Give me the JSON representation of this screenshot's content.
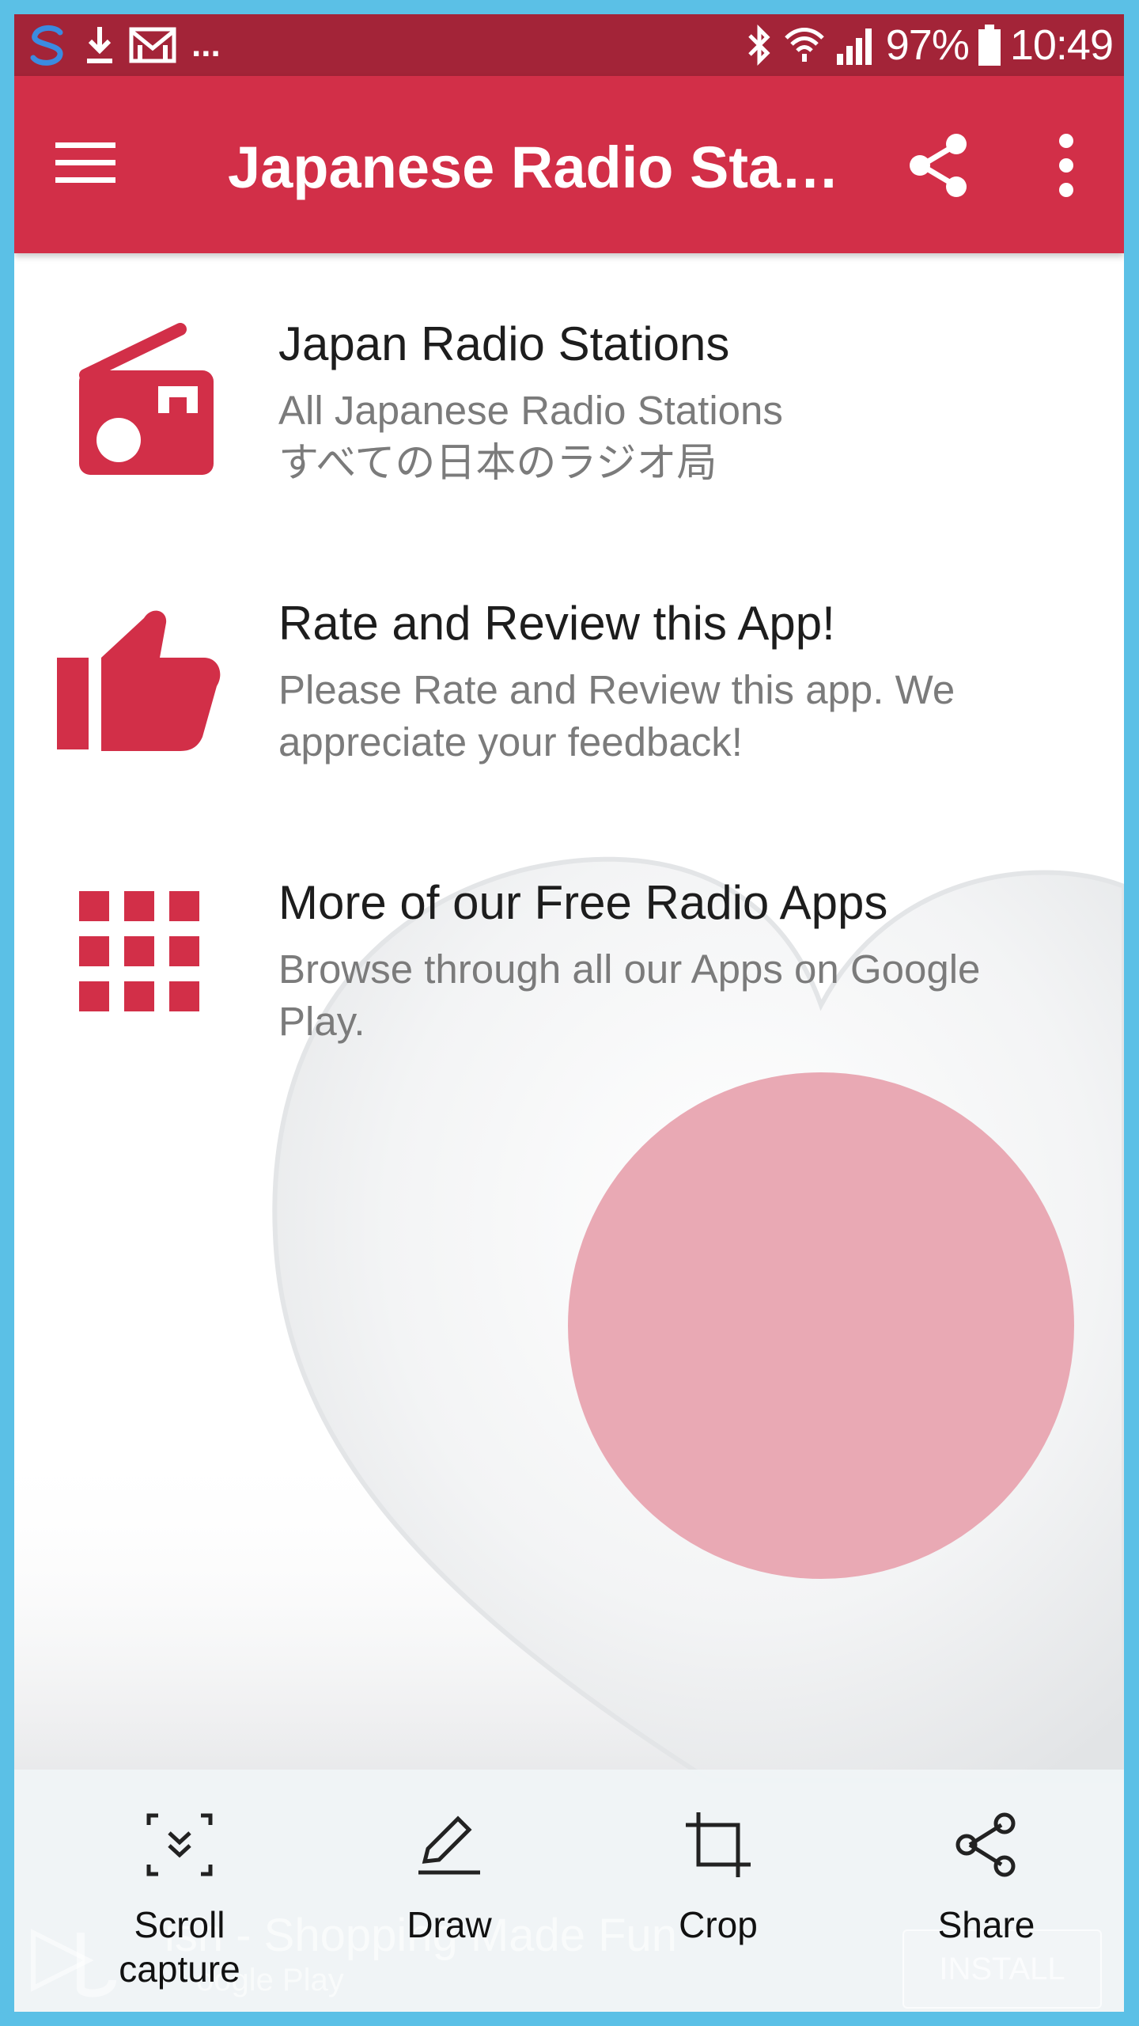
{
  "status_bar": {
    "battery": "97%",
    "time": "10:49",
    "overflow_indicator": "...",
    "icons_left": [
      "s-app-icon",
      "download-icon",
      "gmail-icon"
    ],
    "icons_right": [
      "bluetooth-icon",
      "wifi-icon",
      "signal-icon",
      "battery-icon"
    ]
  },
  "app_bar": {
    "title": "Japanese Radio Sta…",
    "color": "#d22f48"
  },
  "menu": {
    "items": [
      {
        "title": "Japan Radio Stations",
        "desc_line1": "All Japanese Radio Stations",
        "desc_line2": "すべての日本のラジオ局",
        "icon": "radio-icon"
      },
      {
        "title": "Rate and Review this App!",
        "desc": "Please Rate and Review this app. We appreciate your feedback!",
        "icon": "thumbs-up-icon"
      },
      {
        "title": "More of our Free Radio Apps",
        "desc": "Browse through all our Apps on Google Play.",
        "icon": "grid-icon"
      }
    ]
  },
  "toolbar": {
    "scroll_capture": "Scroll\ncapture",
    "draw": "Draw",
    "crop": "Crop",
    "share": "Share"
  },
  "ad": {
    "title": "ish - Shopping Made Fun",
    "subtitle": "oogle Play",
    "install": "INSTALL"
  },
  "colors": {
    "accent": "#d22f48",
    "status_bar": "#a32438",
    "flag_circle": "#e9a9b4",
    "frame": "#5bc0e6"
  }
}
